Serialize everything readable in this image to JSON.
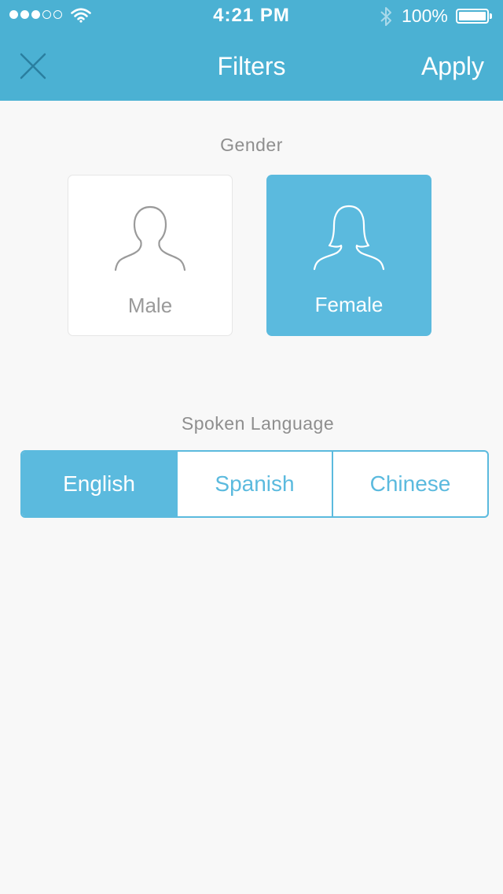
{
  "status_bar": {
    "time": "4:21 PM",
    "battery": "100%",
    "signal_bars_filled": 3,
    "signal_bars_total": 5
  },
  "nav": {
    "title": "Filters",
    "apply_label": "Apply",
    "close_icon": "close-icon"
  },
  "gender": {
    "label": "Gender",
    "options": [
      {
        "label": "Male",
        "icon": "male-person-icon",
        "selected": false
      },
      {
        "label": "Female",
        "icon": "female-person-icon",
        "selected": true
      }
    ]
  },
  "language": {
    "label": "Spoken Language",
    "options": [
      {
        "label": "English",
        "selected": true
      },
      {
        "label": "Spanish",
        "selected": false
      },
      {
        "label": "Chinese",
        "selected": false
      }
    ]
  },
  "colors": {
    "header": "#4bb1d3",
    "accent": "#5bbade",
    "background": "#f8f8f8",
    "muted_text": "#8e8e8e",
    "close_icon": "#2a7fa0"
  }
}
